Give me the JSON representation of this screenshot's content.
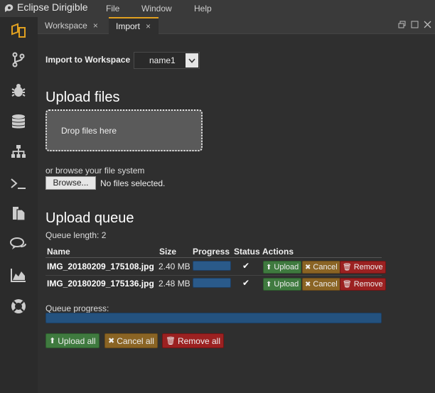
{
  "app": {
    "title": "Eclipse Dirigible"
  },
  "menu": [
    "File",
    "Window",
    "Help"
  ],
  "activity_icons": [
    "workspace-icon",
    "git-branch-icon",
    "debug-bug-icon",
    "database-icon",
    "hierarchy-icon",
    "terminal-icon",
    "documents-icon",
    "chat-icon",
    "area-chart-icon",
    "help-lifebuoy-icon"
  ],
  "tabs": [
    {
      "label": "Workspace",
      "close": "×"
    },
    {
      "label": "Import",
      "close": "×"
    }
  ],
  "import": {
    "label": "Import to Workspace",
    "workspace_value": "name1"
  },
  "upload": {
    "title": "Upload files",
    "drop_label": "Drop files here",
    "browse_text": "or browse your file system",
    "browse_button": "Browse...",
    "no_files": "No files selected."
  },
  "queue": {
    "title": "Upload queue",
    "length_text": "Queue length: 2",
    "headers": [
      "Name",
      "Size",
      "Progress",
      "Status",
      "Actions"
    ],
    "rows": [
      {
        "name": "IMG_20180209_175108.jpg",
        "size": "2.40 MB",
        "progress": 1.0,
        "status": "✔"
      },
      {
        "name": "IMG_20180209_175136.jpg",
        "size": "2.48 MB",
        "progress": 1.0,
        "status": "✔"
      }
    ],
    "row_actions": {
      "upload": "Upload",
      "cancel": "Cancel",
      "remove": "Remove"
    },
    "progress_label": "Queue progress:",
    "overall_progress": 1.0,
    "upload_all": "Upload all",
    "cancel_all": "Cancel all",
    "remove_all": "Remove all"
  },
  "colors": {
    "accent_tab": "#e0a020",
    "green": "#3f7a3f",
    "orange": "#8a6424",
    "red": "#9b2121",
    "progress": "#2a5a8a"
  }
}
